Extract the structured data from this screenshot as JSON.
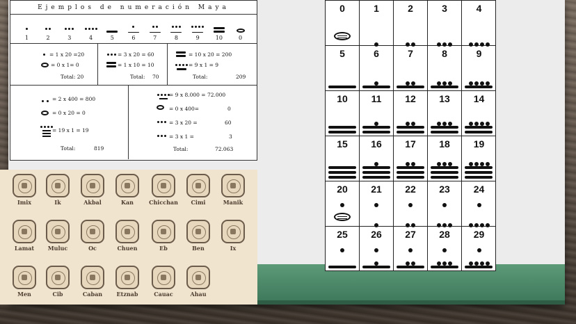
{
  "examples": {
    "title": "Ejemplos de numeración Maya",
    "row1_numbers": [
      "1",
      "2",
      "3",
      "4",
      "5",
      "6",
      "7",
      "8",
      "9",
      "10",
      "0"
    ],
    "ex1": {
      "l1": "= 1 x 20 =20",
      "l2": "=    0 x 1= 0",
      "total": "Total: 20"
    },
    "ex2": {
      "l1": "= 3 x 20 = 60",
      "l2": "= 1 x 10 = 10",
      "total_label": "Total:",
      "total_value": "70"
    },
    "ex3": {
      "l1": "= 10 x 20 = 200",
      "l2": "=  9 x 1  =     9",
      "total_label": "Total:",
      "total_value": "209"
    },
    "ex4": {
      "l1": "= 2 x 400 = 800",
      "l2": "= 0 x 20 =      0",
      "l3": "= 19 x 1 =     19",
      "total_label": "Total:",
      "total_value": "819"
    },
    "ex5": {
      "l1": "= 9 x 8.000 = 72.000",
      "l2a": "= 0 x 400=",
      "l2b": "0",
      "l3a": "= 3 x 20 =",
      "l3b": "60",
      "l4a": "= 3 x 1 =",
      "l4b": "3",
      "total_label": "Total:",
      "total_value": "72.063"
    }
  },
  "signs": [
    "Imix",
    "Ik",
    "Akbal",
    "Kan",
    "Chicchan",
    "Cimi",
    "Manik",
    "Lamat",
    "Muluc",
    "Oc",
    "Chuen",
    "Eb",
    "Ben",
    "Ix",
    "Men",
    "Cib",
    "Caban",
    "Etznab",
    "Cauac",
    "Ahau"
  ],
  "numerals": [
    "0",
    "1",
    "2",
    "3",
    "4",
    "5",
    "6",
    "7",
    "8",
    "9",
    "10",
    "11",
    "12",
    "13",
    "14",
    "15",
    "16",
    "17",
    "18",
    "19",
    "20",
    "21",
    "22",
    "23",
    "24",
    "25",
    "26",
    "27",
    "28",
    "29"
  ],
  "colors": {
    "board": "#ececec",
    "band": "#4f8b6a",
    "parchment": "#f1e4cf"
  }
}
